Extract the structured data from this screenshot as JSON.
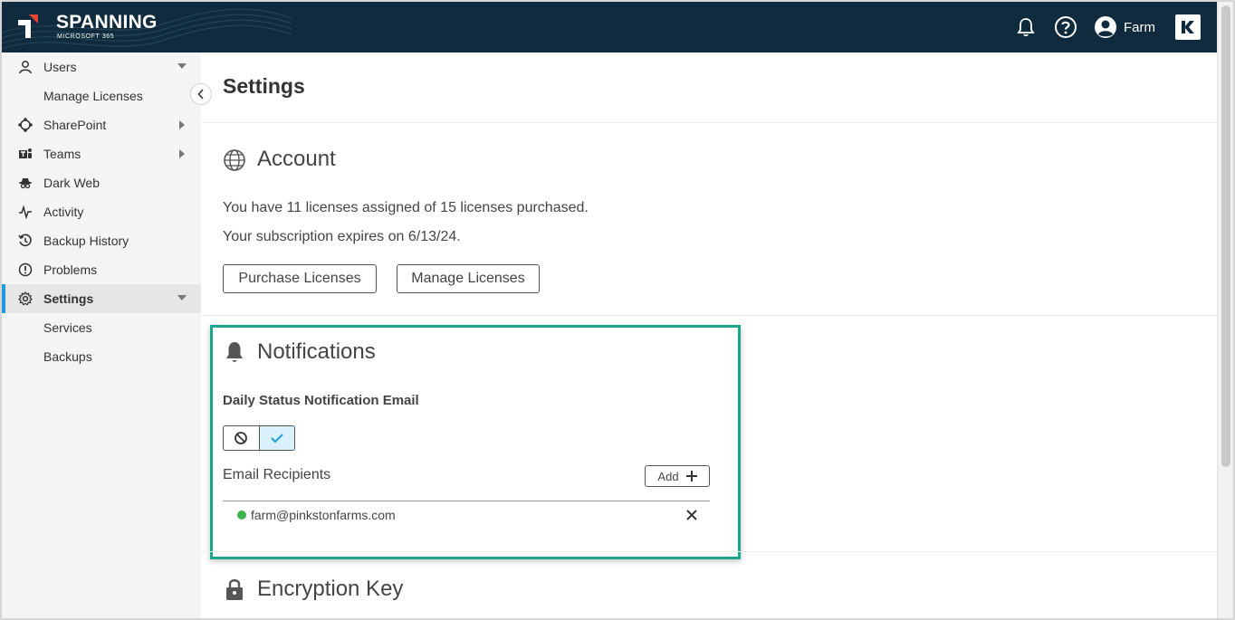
{
  "header": {
    "brand_title": "SPANNING",
    "brand_subtitle": "MICROSOFT 365",
    "user_name": "Farm",
    "icons": [
      "bell-icon",
      "help-icon",
      "user-avatar-icon",
      "kaseya-k-icon"
    ]
  },
  "sidebar": {
    "items": [
      {
        "label": "Users",
        "icon": "user-icon",
        "arrow": "down"
      },
      {
        "label": "Manage Licenses",
        "icon": "",
        "arrow": ""
      },
      {
        "label": "SharePoint",
        "icon": "sharepoint-icon",
        "arrow": "right"
      },
      {
        "label": "Teams",
        "icon": "teams-icon",
        "arrow": "right"
      },
      {
        "label": "Dark Web",
        "icon": "dark-web-icon",
        "arrow": ""
      },
      {
        "label": "Activity",
        "icon": "activity-icon",
        "arrow": ""
      },
      {
        "label": "Backup History",
        "icon": "history-icon",
        "arrow": ""
      },
      {
        "label": "Problems",
        "icon": "problems-icon",
        "arrow": ""
      },
      {
        "label": "Settings",
        "icon": "gear-icon",
        "arrow": "down"
      },
      {
        "label": "Services",
        "icon": "",
        "arrow": ""
      },
      {
        "label": "Backups",
        "icon": "",
        "arrow": ""
      }
    ],
    "active": "Settings"
  },
  "main": {
    "page_title": "Settings",
    "account": {
      "title": "Account",
      "licenses_text": "You have 11 licenses assigned of 15 licenses purchased.",
      "expiry_text": "Your subscription expires on 6/13/24.",
      "purchase_label": "Purchase Licenses",
      "manage_label": "Manage Licenses"
    },
    "notifications": {
      "title": "Notifications",
      "daily_label": "Daily Status Notification Email",
      "toggle_state": "on",
      "recipients_label": "Email Recipients",
      "add_label": "Add",
      "recipients": [
        {
          "email": "farm@pinkstonfarms.com",
          "status_color": "#3fb34f"
        }
      ]
    },
    "encryption": {
      "title": "Encryption Key"
    }
  },
  "colors": {
    "header_bg": "#0f2b3d",
    "accent": "#1f9bd7",
    "highlight_border": "#1aa68b",
    "logo_red": "#e8452f"
  }
}
